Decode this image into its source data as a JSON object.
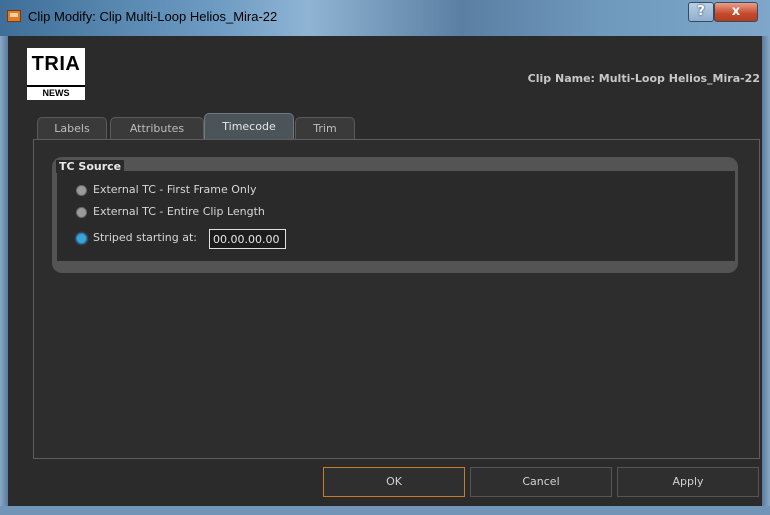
{
  "window": {
    "title": "Clip Modify: Clip Multi-Loop Helios_Mira-22",
    "help_label": "?",
    "close_label": "x"
  },
  "header": {
    "logo_main": "TRIA",
    "logo_sub": "NEWS",
    "clip_name": "Clip Name: Multi-Loop Helios_Mira-22"
  },
  "tabs": [
    {
      "label": "Labels",
      "active": false
    },
    {
      "label": "Attributes",
      "active": false
    },
    {
      "label": "Timecode",
      "active": true
    },
    {
      "label": "Trim",
      "active": false
    }
  ],
  "tc_source": {
    "title": "TC Source",
    "options": [
      {
        "label": "External TC - First Frame Only",
        "checked": false
      },
      {
        "label": "External TC - Entire Clip Length",
        "checked": false
      },
      {
        "label": "Striped starting at:",
        "checked": true
      }
    ],
    "striped_value": "00.00.00.00"
  },
  "buttons": {
    "ok": "OK",
    "cancel": "Cancel",
    "apply": "Apply"
  },
  "colors": {
    "accent_radio": "#3ca3d8",
    "ok_border": "#c77a2a"
  }
}
